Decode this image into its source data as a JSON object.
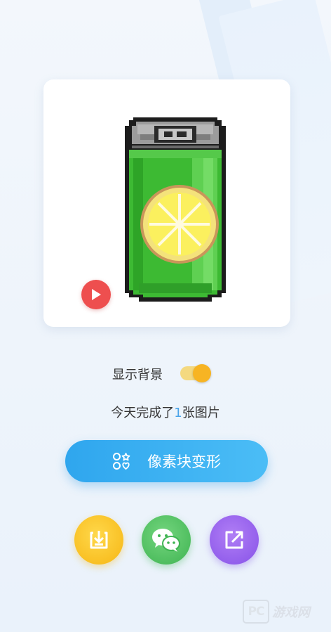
{
  "artwork": {
    "subject": "pixel soda can with lemon slice",
    "play_icon": "play-icon"
  },
  "settings": {
    "show_background_label": "显示背景",
    "show_background_on": true
  },
  "progress": {
    "prefix": "今天完成了",
    "count": "1",
    "suffix": "张图片"
  },
  "primary_action": {
    "label": "像素块变形",
    "icon": "pixel-shapes-icon"
  },
  "actions": [
    {
      "name": "save",
      "icon": "download-icon"
    },
    {
      "name": "wechat",
      "icon": "wechat-icon"
    },
    {
      "name": "share",
      "icon": "share-icon"
    }
  ],
  "watermark": {
    "box_text": "PC",
    "text": "游戏网"
  },
  "colors": {
    "accent_blue": "#2fa6ee",
    "toggle_on": "#f7b423",
    "play_red": "#ee4f4f",
    "save_yellow": "#f6b614",
    "wechat_green": "#3fb452",
    "share_purple": "#8752e8"
  }
}
